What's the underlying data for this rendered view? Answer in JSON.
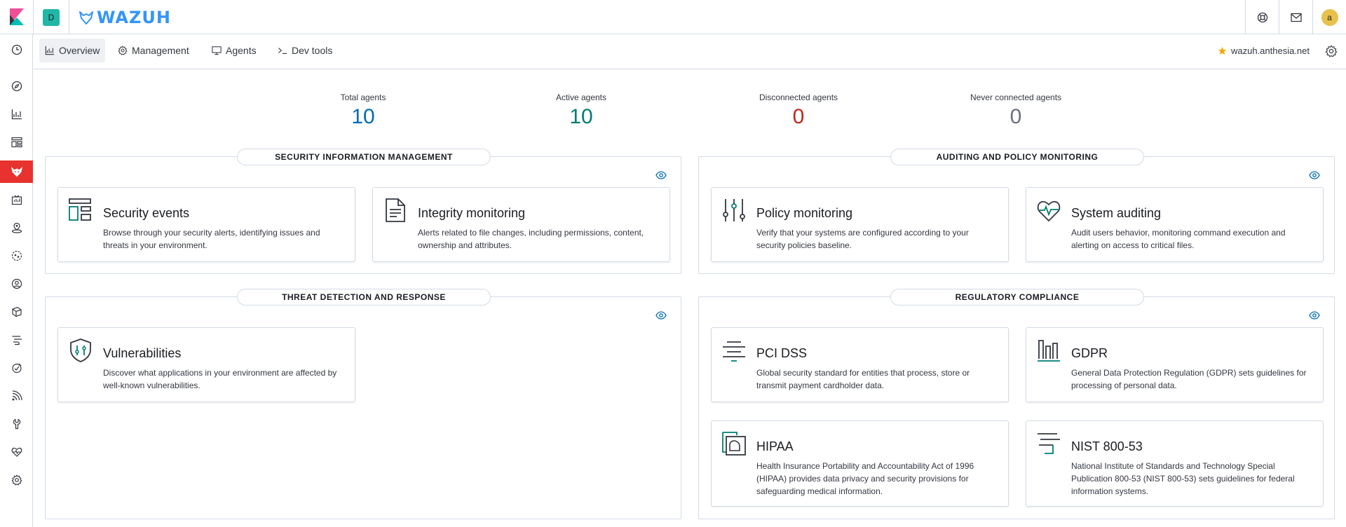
{
  "header": {
    "space_initial": "D",
    "brand": "WAZUH",
    "avatar_initial": "a"
  },
  "tabs": [
    {
      "label": "Overview"
    },
    {
      "label": "Management"
    },
    {
      "label": "Agents"
    },
    {
      "label": "Dev tools"
    }
  ],
  "environment": {
    "label": "wazuh.anthesia.net"
  },
  "stats": [
    {
      "label": "Total agents",
      "value": "10",
      "color": "#006bb4"
    },
    {
      "label": "Active agents",
      "value": "10",
      "color": "#017d73"
    },
    {
      "label": "Disconnected agents",
      "value": "0",
      "color": "#bd271e"
    },
    {
      "label": "Never connected agents",
      "value": "0",
      "color": "#69707d"
    }
  ],
  "sections": {
    "sim": {
      "title": "SECURITY INFORMATION MANAGEMENT"
    },
    "apm": {
      "title": "AUDITING AND POLICY MONITORING"
    },
    "tdr": {
      "title": "THREAT DETECTION AND RESPONSE"
    },
    "rc": {
      "title": "REGULATORY COMPLIANCE"
    }
  },
  "cards": {
    "security_events": {
      "title": "Security events",
      "desc": "Browse through your security alerts, identifying issues and threats in your environment."
    },
    "integrity_monitoring": {
      "title": "Integrity monitoring",
      "desc": "Alerts related to file changes, including permissions, content, ownership and attributes."
    },
    "policy_monitoring": {
      "title": "Policy monitoring",
      "desc": "Verify that your systems are configured according to your security policies baseline."
    },
    "system_auditing": {
      "title": "System auditing",
      "desc": "Audit users behavior, monitoring command execution and alerting on access to critical files."
    },
    "vulnerabilities": {
      "title": "Vulnerabilities",
      "desc": "Discover what applications in your environment are affected by well-known vulnerabilities."
    },
    "pci_dss": {
      "title": "PCI DSS",
      "desc": "Global security standard for entities that process, store or transmit payment cardholder data."
    },
    "gdpr": {
      "title": "GDPR",
      "desc": "General Data Protection Regulation (GDPR) sets guidelines for processing of personal data."
    },
    "hipaa": {
      "title": "HIPAA",
      "desc": "Health Insurance Portability and Accountability Act of 1996 (HIPAA) provides data privacy and security provisions for safeguarding medical information."
    },
    "nist": {
      "title": "NIST 800-53",
      "desc": "National Institute of Standards and Technology Special Publication 800-53 (NIST 800-53) sets guidelines for federal information systems."
    }
  },
  "colors": {
    "accent": "#006bb4",
    "teal": "#017d73",
    "nav_active": "#e7322f",
    "brand_blue": "#3595f9"
  }
}
